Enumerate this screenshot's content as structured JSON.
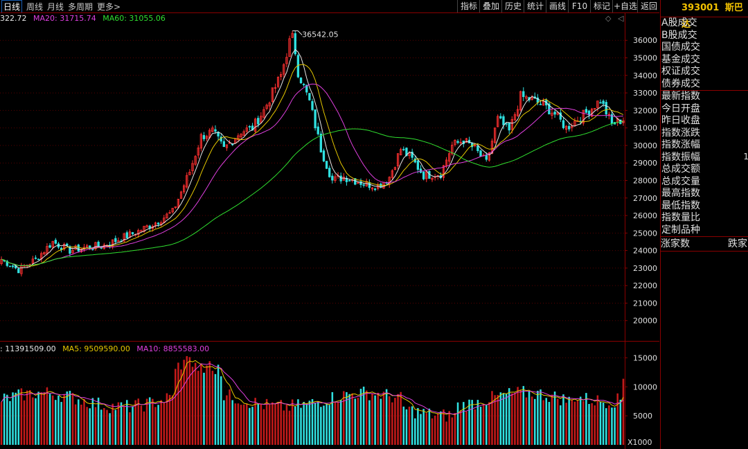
{
  "toolbar": {
    "periods": [
      "日线",
      "周线",
      "月线",
      "多周期",
      "更多>"
    ],
    "buttons": [
      "指标",
      "叠加",
      "历史",
      "统计",
      "画线",
      "F10",
      "标记",
      "+自选",
      "返回"
    ]
  },
  "price_legend": {
    "ma_label": "322.72",
    "ma20": "MA20: 31715.74",
    "ma60": "MA60: 31055.06"
  },
  "volume_legend": {
    "vol": ": 11391509.00",
    "ma5": "MA5: 9509590.00",
    "ma10": "MA10: 8855583.00"
  },
  "volume_unit": "X1000",
  "right_panel": {
    "code": "393001",
    "name": "斯巴达",
    "group1": [
      "A股成交",
      "B股成交",
      "国债成交",
      "基金成交",
      "权证成交",
      "债券成交"
    ],
    "group2": [
      "最新指数",
      "今日开盘",
      "昨日收盘",
      "指数涨跌",
      "指数涨幅",
      "指数振幅",
      "总成交额",
      "总成交量",
      "最高指数",
      "最低指数",
      "指数量比",
      "定制品种"
    ],
    "amplitude_value": "1",
    "rising": "涨家数",
    "falling": "跌家"
  },
  "colors": {
    "up": "#ff3030",
    "down": "#30e0e0",
    "ma_w": "#e8e8e8",
    "ma_y": "#e6c800",
    "ma_m": "#e040e0",
    "ma_g": "#30e030",
    "axis": "#8b0000"
  },
  "chart_data": [
    {
      "type": "candlestick",
      "y_ticks": [
        20000,
        21000,
        22000,
        23000,
        24000,
        25000,
        26000,
        27000,
        28000,
        29000,
        30000,
        31000,
        32000,
        33000,
        34000,
        35000,
        36000
      ],
      "ylim": [
        19000,
        36800
      ],
      "annotation": "36542.05",
      "anchors": [
        [
          0,
          23500
        ],
        [
          6,
          22900
        ],
        [
          12,
          23500
        ],
        [
          18,
          24500
        ],
        [
          24,
          24000
        ],
        [
          30,
          24200
        ],
        [
          36,
          24300
        ],
        [
          42,
          24700
        ],
        [
          48,
          25100
        ],
        [
          54,
          25600
        ],
        [
          60,
          26200
        ],
        [
          66,
          28500
        ],
        [
          70,
          30500
        ],
        [
          74,
          30800
        ],
        [
          78,
          29800
        ],
        [
          84,
          30800
        ],
        [
          88,
          31000
        ],
        [
          92,
          32000
        ],
        [
          98,
          34000
        ],
        [
          102,
          36542
        ],
        [
          104,
          34200
        ],
        [
          108,
          32500
        ],
        [
          112,
          29800
        ],
        [
          116,
          28000
        ],
        [
          120,
          28200
        ],
        [
          124,
          28000
        ],
        [
          128,
          27800
        ],
        [
          132,
          27700
        ],
        [
          136,
          28200
        ],
        [
          140,
          29800
        ],
        [
          144,
          29200
        ],
        [
          148,
          28300
        ],
        [
          154,
          28400
        ],
        [
          158,
          30000
        ],
        [
          162,
          30300
        ],
        [
          166,
          29800
        ],
        [
          170,
          29000
        ],
        [
          174,
          31500
        ],
        [
          178,
          30800
        ],
        [
          182,
          32800
        ],
        [
          186,
          32600
        ],
        [
          190,
          32300
        ],
        [
          194,
          31800
        ],
        [
          198,
          31000
        ],
        [
          202,
          31500
        ],
        [
          206,
          32000
        ],
        [
          210,
          32600
        ],
        [
          214,
          31200
        ],
        [
          218,
          31500
        ]
      ],
      "count": 219
    },
    {
      "type": "bar",
      "y_ticks": [
        5000,
        10000,
        15000
      ],
      "ylim": [
        0,
        16000
      ],
      "unit": "X1000"
    }
  ]
}
